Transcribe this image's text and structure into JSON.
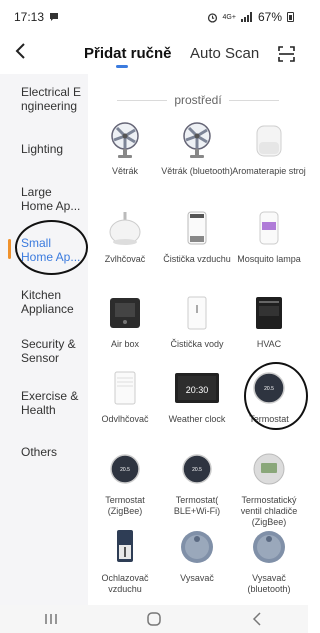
{
  "status": {
    "time": "17:13",
    "network": "4G+",
    "battery": "67%"
  },
  "nav": {
    "tab_manual": "Přidat ručně",
    "tab_auto": "Auto Scan"
  },
  "sidebar": {
    "items": [
      {
        "label": "Electrical E ngineering"
      },
      {
        "label": "Lighting"
      },
      {
        "label": "Large Home Ap..."
      },
      {
        "label": "Small Home Ap..."
      },
      {
        "label": "Kitchen Appliance"
      },
      {
        "label": "Security & Sensor"
      },
      {
        "label": "Exercise & Health"
      },
      {
        "label": "Others"
      }
    ],
    "active_index": 3
  },
  "content": {
    "section_title": "prostředí",
    "devices": [
      {
        "label": "Větrák",
        "icon": "fan-icon"
      },
      {
        "label": "Větrák (bluetooth)",
        "icon": "fan-icon"
      },
      {
        "label": "Aromaterapie stroj",
        "icon": "aroma-diffuser-icon"
      },
      {
        "label": "Zvlhčovač",
        "icon": "humidifier-icon"
      },
      {
        "label": "Čistička vzduchu",
        "icon": "air-purifier-icon"
      },
      {
        "label": "Mosquito lampa",
        "icon": "mosquito-lamp-icon"
      },
      {
        "label": "Air box",
        "icon": "air-box-icon"
      },
      {
        "label": "Čistička vody",
        "icon": "water-purifier-icon"
      },
      {
        "label": "HVAC",
        "icon": "hvac-icon"
      },
      {
        "label": "Odvlhčovač",
        "icon": "dehumidifier-icon"
      },
      {
        "label": "Weather clock",
        "icon": "weather-clock-icon"
      },
      {
        "label": "Termostat",
        "icon": "thermostat-icon"
      },
      {
        "label": "Termostat (ZigBee)",
        "icon": "thermostat-icon"
      },
      {
        "label": "Termostat( BLE+Wi-Fi)",
        "icon": "thermostat-icon"
      },
      {
        "label": "Termostatický ventil chladiče (ZigBee)",
        "icon": "radiator-valve-icon"
      },
      {
        "label": "Ochlazovač vzduchu",
        "icon": "air-cooler-icon"
      },
      {
        "label": "Vysavač",
        "icon": "robot-vacuum-icon"
      },
      {
        "label": "Vysavač (bluetooth)",
        "icon": "robot-vacuum-icon"
      }
    ]
  },
  "display": {
    "thermostat_temp": "20.5",
    "clock_time": "20:30"
  },
  "colors": {
    "accent": "#3b7bde",
    "active_marker": "#f0922c",
    "sidebar_bg": "#f5f5f7"
  }
}
